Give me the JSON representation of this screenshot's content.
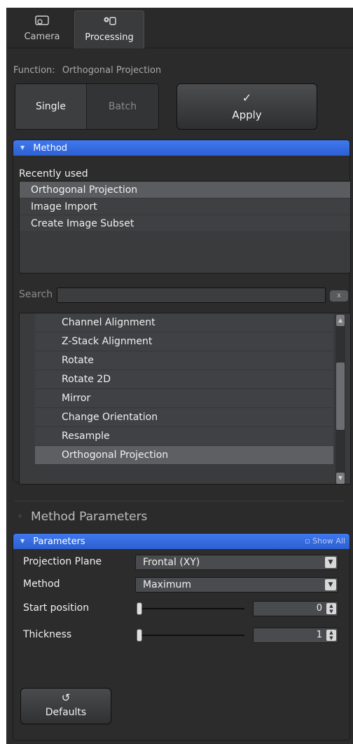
{
  "tabs": [
    {
      "label": "Camera",
      "icon": "camera-icon"
    },
    {
      "label": "Processing",
      "icon": "gear-icon",
      "active": true
    }
  ],
  "function_row": {
    "label": "Function:",
    "value": "Orthogonal Projection"
  },
  "mode": {
    "single": "Single",
    "batch": "Batch",
    "selected": "Single"
  },
  "apply": {
    "label": "Apply",
    "icon": "checkmark-icon"
  },
  "method_section": {
    "header": "Method",
    "recent_label": "Recently used",
    "recent_items": [
      "Orthogonal Projection",
      "Image Import",
      "Create Image Subset"
    ],
    "search_label": "Search",
    "search_value": "",
    "search_clear": "x",
    "functions": [
      "Channel Alignment",
      "Z-Stack Alignment",
      "Rotate",
      "Rotate 2D",
      "Mirror",
      "Change Orientation",
      "Resample",
      "Orthogonal Projection"
    ],
    "selected_function": "Orthogonal Projection"
  },
  "method_parameters_title": "Method Parameters",
  "parameters_section": {
    "header": "Parameters",
    "show_all": "Show All",
    "projection_plane": {
      "label": "Projection Plane",
      "value": "Frontal (XY)"
    },
    "method": {
      "label": "Method",
      "value": "Maximum"
    },
    "start_position": {
      "label": "Start position",
      "value": "0"
    },
    "thickness": {
      "label": "Thickness",
      "value": "1"
    },
    "defaults_label": "Defaults"
  },
  "colors": {
    "accent": "#3f79ee",
    "panel": "#2b2b2c"
  }
}
